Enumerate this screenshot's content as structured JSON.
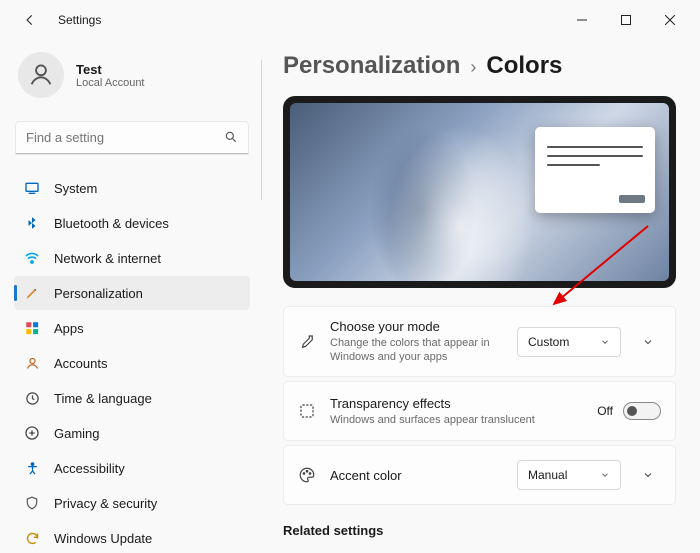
{
  "window": {
    "title": "Settings"
  },
  "profile": {
    "name": "Test",
    "sub": "Local Account"
  },
  "search": {
    "placeholder": "Find a setting"
  },
  "nav": [
    {
      "key": "system",
      "label": "System"
    },
    {
      "key": "bluetooth",
      "label": "Bluetooth & devices"
    },
    {
      "key": "network",
      "label": "Network & internet"
    },
    {
      "key": "personalization",
      "label": "Personalization"
    },
    {
      "key": "apps",
      "label": "Apps"
    },
    {
      "key": "accounts",
      "label": "Accounts"
    },
    {
      "key": "time",
      "label": "Time & language"
    },
    {
      "key": "gaming",
      "label": "Gaming"
    },
    {
      "key": "accessibility",
      "label": "Accessibility"
    },
    {
      "key": "privacy",
      "label": "Privacy & security"
    },
    {
      "key": "update",
      "label": "Windows Update"
    }
  ],
  "nav_active": "personalization",
  "breadcrumb": {
    "parent": "Personalization",
    "sep": "›",
    "current": "Colors"
  },
  "rows": {
    "mode": {
      "title": "Choose your mode",
      "sub": "Change the colors that appear in Windows and your apps",
      "value": "Custom"
    },
    "transparency": {
      "title": "Transparency effects",
      "sub": "Windows and surfaces appear translucent",
      "state_label": "Off"
    },
    "accent": {
      "title": "Accent color",
      "value": "Manual"
    }
  },
  "related": {
    "heading": "Related settings"
  }
}
